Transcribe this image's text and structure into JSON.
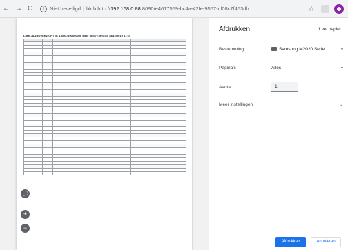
{
  "browser": {
    "nav_back": "←",
    "nav_forward": "→",
    "reload": "C",
    "security_text": "Niet beveiligd",
    "url_prefix": "blob:http://",
    "url_host": "192.168.0.88",
    "url_rest": ":8090/e4617559-bc4a-42fe-9557-cf08c7f453db"
  },
  "print_panel": {
    "title": "Afdrukken",
    "sheet_count": "1 vel papier",
    "destination_label": "Bestemming",
    "destination_value": "Samsung M2020 Serie",
    "pages_label": "Pagina's",
    "pages_value": "Alles",
    "copies_label": "Aantal",
    "copies_value": "1",
    "more_settings": "Meer instellingen",
    "print_button": "Afdrukken",
    "cancel_button": "Annuleren"
  },
  "preview": {
    "title": "LuMi JAAROVERZICHT Id: 15AG7100000006 Mac: 5ccf7f:4f:f1:84  15/12/2019  17:14",
    "zoom_fit": "⛶",
    "zoom_in": "+",
    "zoom_out": "−"
  },
  "colors": {
    "accent": "#1a73e8",
    "profile": "#8e24aa",
    "preview_bg": "#f1f1f1"
  }
}
